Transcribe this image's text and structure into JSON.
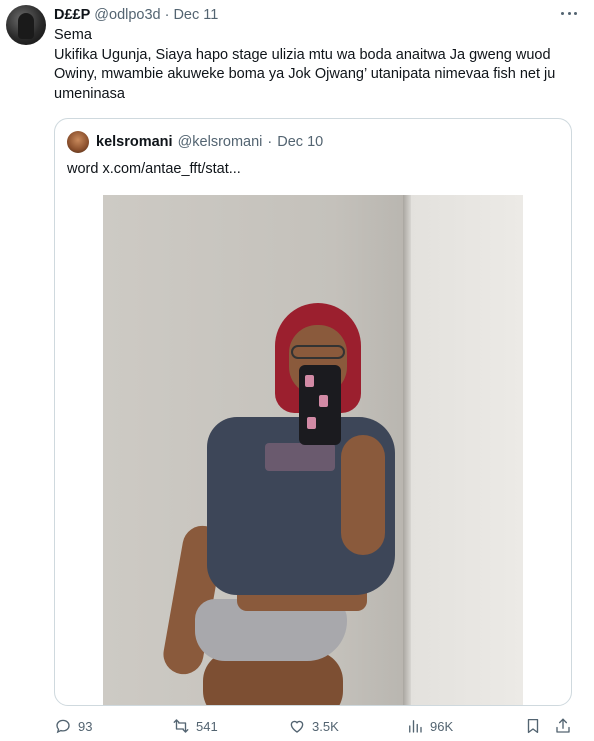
{
  "tweet": {
    "display_name": "D££P",
    "handle": "@odlpo3d",
    "separator": "·",
    "date": "Dec 11",
    "body_lines": [
      "Sema",
      "Ukifika Ugunja, Siaya hapo stage ulizia mtu wa boda anaitwa Ja gweng wuod Owiny, mwambie akuweke boma ya Jok Ojwang’ utanipata nimevaa fish net ju umeninasa"
    ]
  },
  "quoted": {
    "display_name": "kelsromani",
    "handle": "@kelsromani",
    "separator": "·",
    "date": "Dec 10",
    "text_prefix": "word",
    "link": "x.com/antae_fft/stat..."
  },
  "actions": {
    "replies": "93",
    "reposts": "541",
    "likes": "3.5K",
    "views": "96K"
  },
  "icons": {
    "more": "more-horizontal-icon",
    "reply": "reply-icon",
    "repost": "repost-icon",
    "like": "heart-icon",
    "views": "views-chart-icon",
    "bookmark": "bookmark-icon",
    "share": "share-icon"
  },
  "colors": {
    "text": "#0f1419",
    "muted": "#536471",
    "border": "#cfd9de"
  }
}
